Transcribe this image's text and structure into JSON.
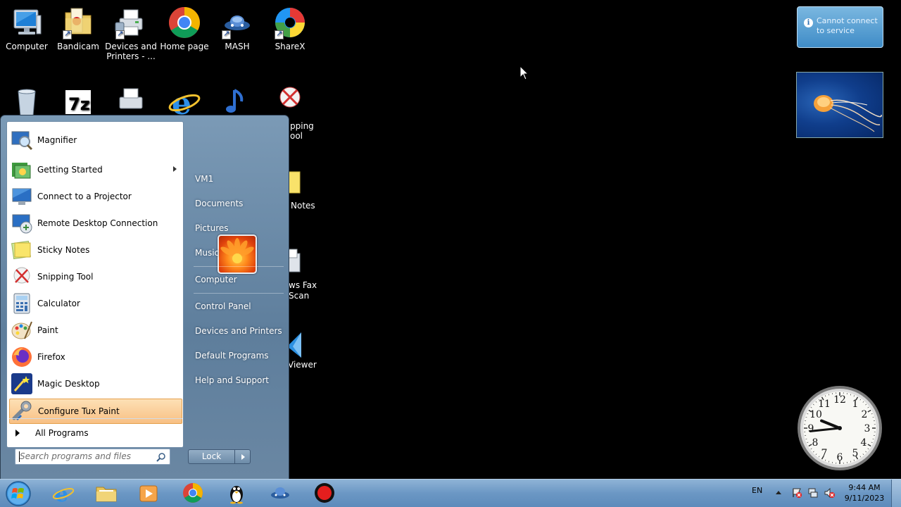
{
  "desktop": {
    "icons": [
      {
        "label": "Computer",
        "icon": "computer-icon"
      },
      {
        "label": "Bandicam",
        "icon": "bandicam-icon"
      },
      {
        "label": "Devices and Printers - ...",
        "icon": "printer-icon"
      },
      {
        "label": "Home page",
        "icon": "chrome-icon"
      },
      {
        "label": "MASH",
        "icon": "mash-icon"
      },
      {
        "label": "ShareX",
        "icon": "sharex-icon"
      },
      {
        "label": "Snipping Tool",
        "visible": "pping\nool",
        "icon": "snipping-tool-icon"
      },
      {
        "label": "Sticky Notes",
        "visible": "Notes",
        "icon": "sticky-notes-icon"
      },
      {
        "label": "Windows Fax and Scan",
        "visible": "ws Fax\nScan",
        "icon": "fax-icon"
      },
      {
        "label": "Viewer",
        "visible": "Viewer",
        "icon": "viewer-icon"
      }
    ],
    "partial_labels": {
      "snipping": "pping",
      "snipping2": "ool",
      "notes": "Notes",
      "fax": "ws Fax",
      "fax2": "Scan",
      "viewer": "Viewer"
    }
  },
  "gadgets": {
    "notification": "Cannot connect to service",
    "clock": {
      "hour": 9,
      "minute": 44
    }
  },
  "start_menu": {
    "programs": [
      {
        "label": "Magnifier",
        "icon": "magnifier-icon"
      },
      {
        "label": "Getting Started",
        "icon": "getting-started-icon",
        "submenu": true
      },
      {
        "label": "Connect to a Projector",
        "icon": "projector-icon"
      },
      {
        "label": "Remote Desktop Connection",
        "icon": "remote-desktop-icon"
      },
      {
        "label": "Sticky Notes",
        "icon": "sticky-notes-icon"
      },
      {
        "label": "Snipping Tool",
        "icon": "snipping-tool-icon"
      },
      {
        "label": "Calculator",
        "icon": "calculator-icon"
      },
      {
        "label": "Paint",
        "icon": "paint-icon"
      },
      {
        "label": "Firefox",
        "icon": "firefox-icon"
      },
      {
        "label": "Magic Desktop",
        "icon": "magic-desktop-icon"
      },
      {
        "label": "Configure Tux Paint",
        "icon": "tux-paint-config-icon",
        "highlighted": true
      }
    ],
    "all_programs": "All Programs",
    "search_placeholder": "Search programs and files",
    "right_links": [
      "VM1",
      "Documents",
      "Pictures",
      "Music",
      "Computer",
      "Control Panel",
      "Devices and Printers",
      "Default Programs",
      "Help and Support"
    ],
    "lock_label": "Lock"
  },
  "taskbar": {
    "items": [
      "internet-explorer-icon",
      "file-explorer-icon",
      "media-player-icon",
      "chrome-icon",
      "tux-paint-icon",
      "mash-icon",
      "record-icon"
    ],
    "language": "EN",
    "time": "9:44 AM",
    "date": "9/11/2023"
  },
  "colors": {
    "highlight": "#f8c084",
    "taskbar": "#6b97c4",
    "start_menu_right": "#6a87a3"
  }
}
